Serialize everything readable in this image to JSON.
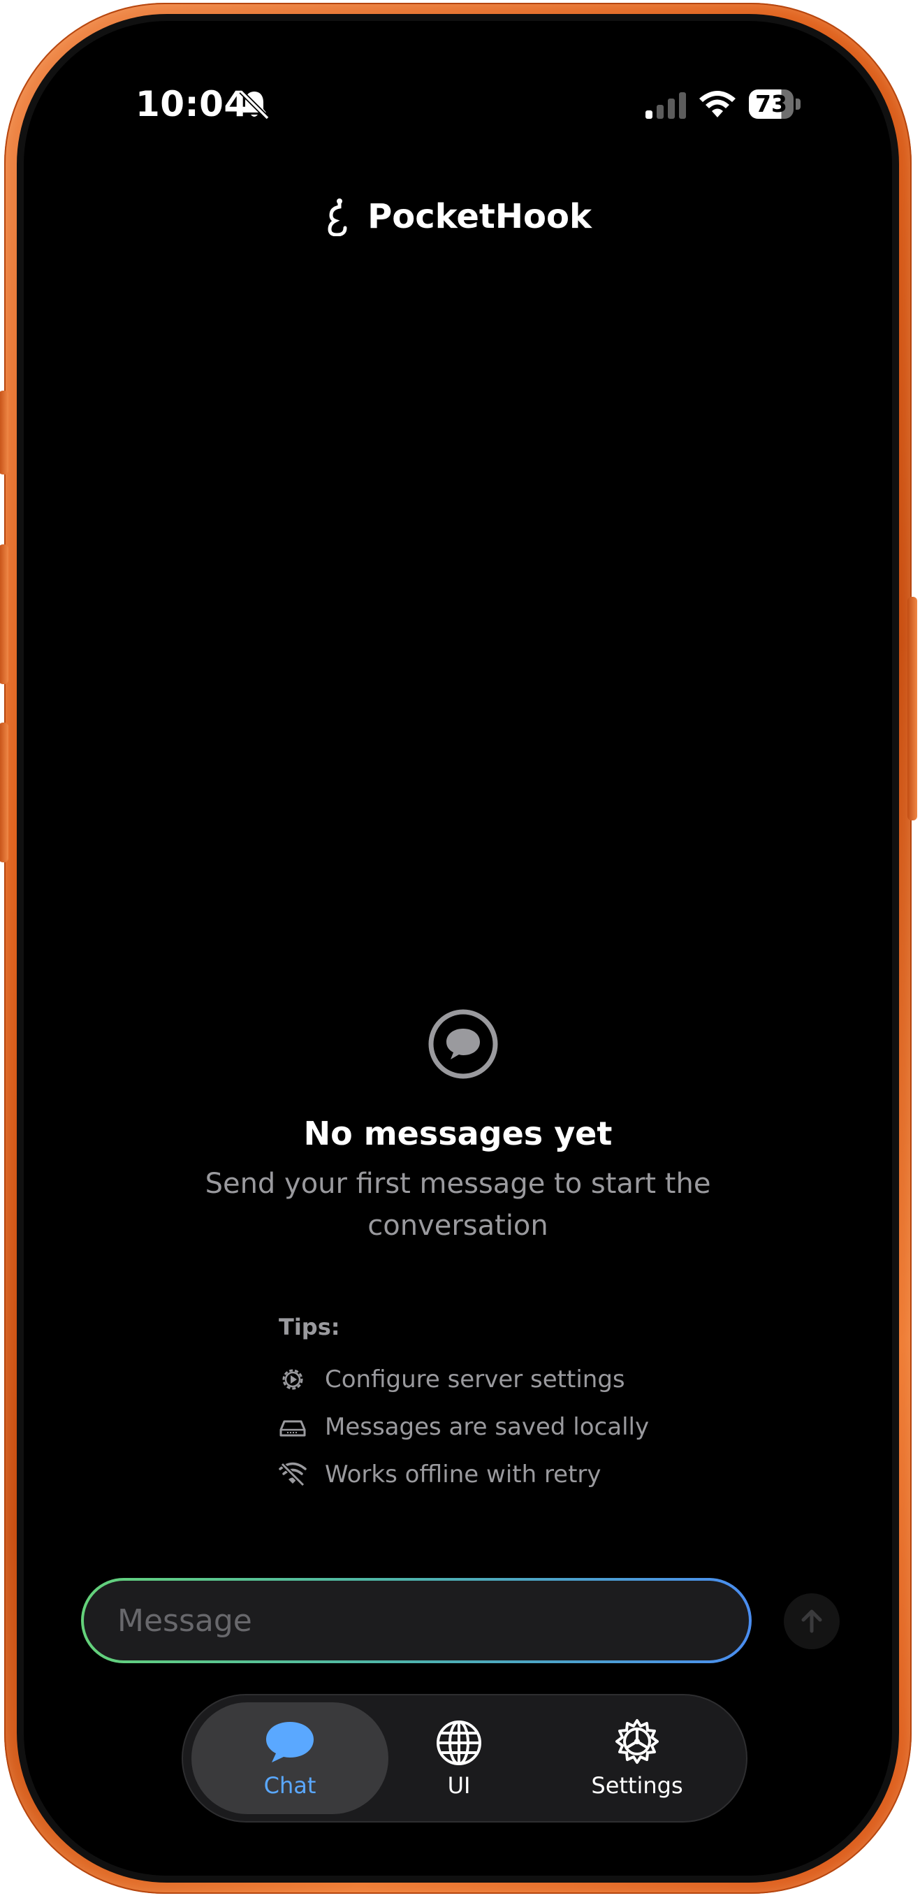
{
  "status_bar": {
    "time": "10:04",
    "battery": "73",
    "battery_level": 0.73,
    "icons": [
      "bell-slash-icon",
      "signal-icon",
      "wifi-icon",
      "battery-icon"
    ]
  },
  "header": {
    "title": "PocketHook",
    "icon": "hook-icon"
  },
  "empty_state": {
    "icon": "chat-bubble-icon",
    "title": "No messages yet",
    "subtitle": "Send your first message to start the conversation"
  },
  "tips": {
    "label": "Tips:",
    "items": [
      {
        "icon": "gear-play-icon",
        "text": "Configure server settings"
      },
      {
        "icon": "storage-icon",
        "text": "Messages are saved locally"
      },
      {
        "icon": "wifi-off-icon",
        "text": "Works offline with retry"
      }
    ]
  },
  "composer": {
    "placeholder": "Message",
    "value": "",
    "voice_icon": "waveform-icon",
    "send_icon": "arrow-up-icon"
  },
  "tabs": [
    {
      "label": "Chat",
      "icon": "chat-bubble-icon",
      "active": true
    },
    {
      "label": "UI",
      "icon": "globe-icon",
      "active": false
    },
    {
      "label": "Settings",
      "icon": "gear-icon",
      "active": false
    }
  ],
  "colors": {
    "accent": "#5aa8ff",
    "frame": "#e0631f",
    "background": "#000000",
    "muted_text": "#9a9a9e"
  }
}
